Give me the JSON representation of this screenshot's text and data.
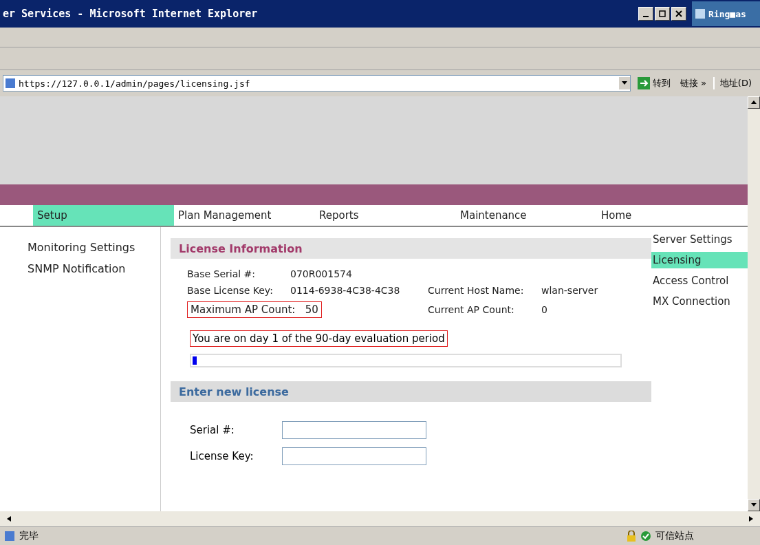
{
  "window": {
    "title": "er Services - Microsoft Internet Explorer",
    "other_window_title": "Ring■as"
  },
  "address_bar": {
    "label": "地址(D)",
    "url": "https://127.0.0.1/admin/pages/licensing.jsf",
    "go": "转到",
    "links": "链接 »"
  },
  "nav_tabs": [
    {
      "label": "Setup",
      "selected": true
    },
    {
      "label": "Plan Management",
      "selected": false
    },
    {
      "label": "Reports",
      "selected": false
    },
    {
      "label": "Maintenance",
      "selected": false
    },
    {
      "label": "Home",
      "selected": false
    }
  ],
  "left_menu": [
    {
      "label": "Monitoring Settings"
    },
    {
      "label": "SNMP Notification"
    }
  ],
  "right_menu": [
    {
      "label": "Server Settings",
      "selected": false
    },
    {
      "label": "Licensing",
      "selected": true
    },
    {
      "label": "Access Control",
      "selected": false
    },
    {
      "label": "MX Connection",
      "selected": false
    }
  ],
  "license_info": {
    "title": "License Information",
    "rows": [
      [
        {
          "label": "Base Serial #:",
          "value": "070R001574",
          "highlighted": false
        }
      ],
      [
        {
          "label": "Base License Key:",
          "value": "0114-6938-4C38-4C38",
          "highlighted": false
        },
        {
          "label": "Current Host Name:",
          "value": "wlan-server",
          "highlighted": false
        }
      ],
      [
        {
          "label": "Maximum AP Count:",
          "value": "50",
          "highlighted": true
        },
        {
          "label": "Current AP Count:",
          "value": "0",
          "highlighted": false
        }
      ]
    ],
    "evaluation": "You are on day 1 of the 90-day evaluation period",
    "progress": {
      "level": 0.01
    }
  },
  "new_license": {
    "title": "Enter new license",
    "fields": [
      {
        "label": "Serial #:"
      },
      {
        "label": "License Key:"
      }
    ]
  },
  "status_bar": {
    "status": "完毕",
    "zone": "可信站点"
  }
}
